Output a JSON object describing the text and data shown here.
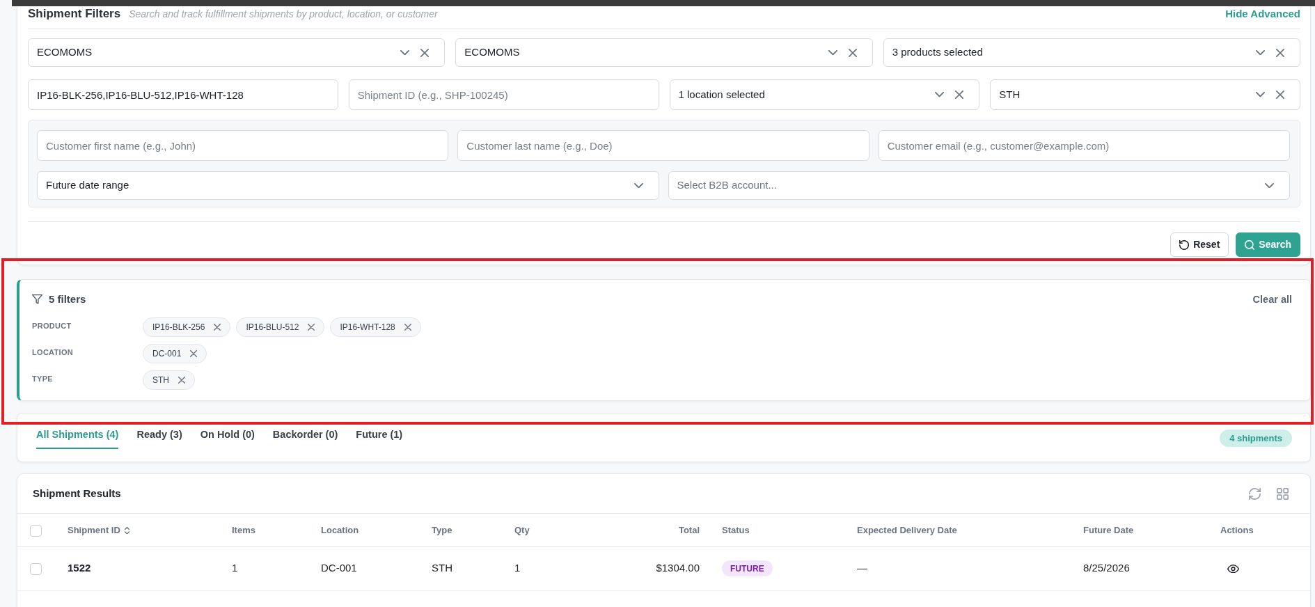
{
  "filters": {
    "title": "Shipment Filters",
    "subtitle": "Search and track fulfillment shipments by product, location, or customer",
    "toggle_link": "Hide Advanced",
    "rows": [
      [
        {
          "kind": "select",
          "value": "ECOMOMS",
          "clearable": true
        },
        {
          "kind": "select",
          "value": "ECOMOMS",
          "clearable": true
        },
        {
          "kind": "select",
          "value": "3 products selected",
          "clearable": true
        }
      ],
      [
        {
          "kind": "input",
          "value": "IP16-BLK-256,IP16-BLU-512,IP16-WHT-128"
        },
        {
          "kind": "input",
          "placeholder": "Shipment ID (e.g., SHP-100245)"
        },
        {
          "kind": "select",
          "value": "1 location selected",
          "clearable": true
        },
        {
          "kind": "select",
          "value": "STH",
          "clearable": true
        }
      ]
    ],
    "advanced": {
      "expanded": true,
      "rows": [
        [
          {
            "kind": "input",
            "placeholder": "Customer first name (e.g., John)"
          },
          {
            "kind": "input",
            "placeholder": "Customer last name (e.g., Doe)"
          },
          {
            "kind": "input",
            "placeholder": "Customer email (e.g., customer@example.com)"
          }
        ],
        [
          {
            "kind": "select",
            "value": "Future date range",
            "clearable": false
          },
          {
            "kind": "select",
            "placeholder": "Select B2B account...",
            "clearable": false
          }
        ]
      ]
    },
    "buttons": [
      {
        "kind": "reset",
        "label": "Reset"
      },
      {
        "kind": "submit",
        "label": "Search"
      }
    ]
  },
  "active_filters": {
    "highlighted": true,
    "count": "5 filters",
    "clear": "Clear all",
    "groups": [
      {
        "label": "PRODUCT",
        "chips": [
          "IP16-BLK-256",
          "IP16-BLU-512",
          "IP16-WHT-128"
        ]
      },
      {
        "label": "LOCATION",
        "chips": [
          "DC-001"
        ]
      },
      {
        "label": "TYPE",
        "chips": [
          "STH"
        ]
      }
    ]
  },
  "status_tabs": {
    "tabs": [
      {
        "label": "All Shipments (4)",
        "selected": true
      },
      {
        "label": "Ready (3)",
        "selected": false
      },
      {
        "label": "On Hold (0)",
        "selected": false
      },
      {
        "label": "Backorder (0)",
        "selected": false
      },
      {
        "label": "Future (1)",
        "selected": false
      }
    ],
    "count_badge": "4 shipments"
  },
  "results": {
    "title": "Shipment Results",
    "table": {
      "columns": [
        {
          "kind": "checkbox",
          "checked": false
        },
        {
          "kind": "id",
          "label": "Shipment ID",
          "sortable": true
        },
        {
          "kind": "text",
          "label": "Items",
          "sortable": false
        },
        {
          "kind": "text",
          "label": "Location",
          "sortable": false
        },
        {
          "kind": "text",
          "label": "Type",
          "sortable": false
        },
        {
          "kind": "text",
          "label": "Qty",
          "sortable": false
        },
        {
          "kind": "amount",
          "label": "Total",
          "sortable": false
        },
        {
          "kind": "status",
          "label": "Status",
          "sortable": false
        },
        {
          "kind": "text",
          "label": "Expected Delivery Date",
          "sortable": false
        },
        {
          "kind": "text",
          "label": "Future Date",
          "sortable": false
        },
        {
          "kind": "actions",
          "label": "Actions",
          "sortable": false
        }
      ],
      "rows": [
        {
          "cells": [
            {
              "checked": false
            },
            "1522",
            "1",
            "DC-001",
            "STH",
            "1",
            "$1304.00",
            {
              "label": "FUTURE",
              "kind": "future"
            },
            "—",
            "8/25/2026"
          ]
        }
      ]
    }
  }
}
